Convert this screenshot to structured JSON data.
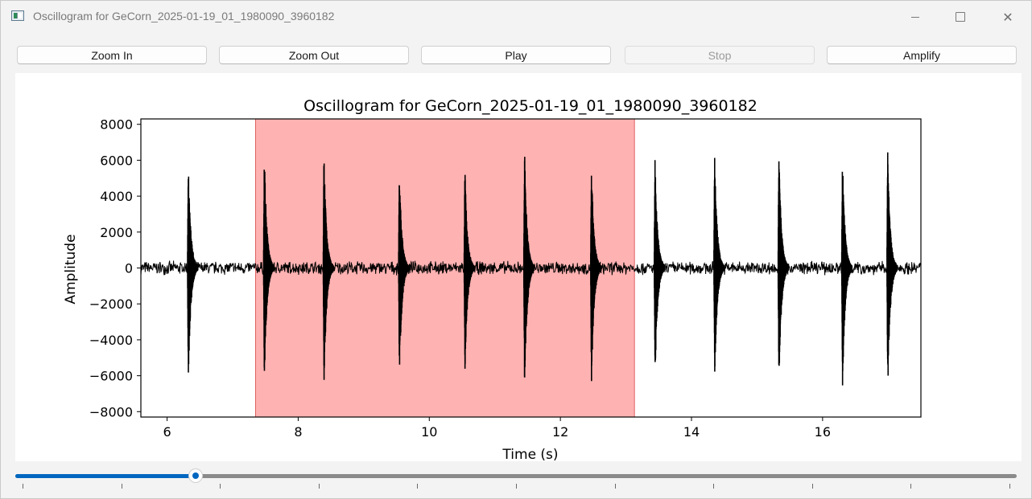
{
  "window": {
    "title": "Oscillogram for GeCorn_2025-01-19_01_1980090_3960182",
    "controls": [
      "minimize",
      "maximize",
      "close"
    ]
  },
  "toolbar": {
    "zoom_in_label": "Zoom In",
    "zoom_out_label": "Zoom Out",
    "play_label": "Play",
    "stop_label": "Stop",
    "stop_disabled": true,
    "amplify_label": "Amplify"
  },
  "slider": {
    "value_fraction": 0.175,
    "tick_count": 11,
    "accent": "#0067c0"
  },
  "chart_data": {
    "type": "line",
    "title": "Oscillogram for GeCorn_2025-01-19_01_1980090_3960182",
    "xlabel": "Time (s)",
    "ylabel": "Amplitude",
    "xlim": [
      5.6,
      17.5
    ],
    "ylim": [
      -8300,
      8300
    ],
    "xticks": [
      "6",
      "8",
      "10",
      "12",
      "14",
      "16"
    ],
    "yticks": [
      "8000",
      "6000",
      "4000",
      "2000",
      "0",
      "−2000",
      "−4000",
      "−6000",
      "−8000"
    ],
    "xtick_values": [
      6,
      8,
      10,
      12,
      14,
      16
    ],
    "ytick_values": [
      8000,
      6000,
      4000,
      2000,
      0,
      -2000,
      -4000,
      -6000,
      -8000
    ],
    "line_color": "#000000",
    "baseline_noise_amplitude": 300,
    "selection": {
      "start": 7.35,
      "end": 13.13,
      "color": "#ff7f7f"
    },
    "pulses": [
      {
        "t": 6.33,
        "max": 6200,
        "min": -6400
      },
      {
        "t": 7.49,
        "max": 6800,
        "min": -6300
      },
      {
        "t": 8.4,
        "max": 6600,
        "min": -6700
      },
      {
        "t": 9.55,
        "max": 5800,
        "min": -6300
      },
      {
        "t": 10.55,
        "max": 5700,
        "min": -5900
      },
      {
        "t": 11.46,
        "max": 6800,
        "min": -7000
      },
      {
        "t": 12.48,
        "max": 6100,
        "min": -6700
      },
      {
        "t": 13.45,
        "max": 6400,
        "min": -6400
      },
      {
        "t": 14.36,
        "max": 6700,
        "min": -6300
      },
      {
        "t": 15.34,
        "max": 6700,
        "min": -6600
      },
      {
        "t": 16.31,
        "max": 6400,
        "min": -6900
      },
      {
        "t": 17.0,
        "max": 6700,
        "min": -7000
      }
    ]
  }
}
